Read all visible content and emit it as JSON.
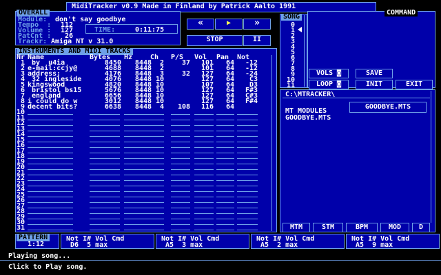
{
  "title": "MidiTracker v0.9 Made in Finland by Patrick Aalto 1991",
  "overall": {
    "header": "OVERALL",
    "fields": [
      {
        "label": "Module:",
        "value": "don't say goodbye"
      },
      {
        "label": "Tempo  :",
        "value": "112"
      },
      {
        "label": "Volume :",
        "value": "127"
      },
      {
        "label": "PatCnt :",
        "value": "26"
      },
      {
        "label": "Trackr:",
        "value": "Amiga NT v 31.0"
      }
    ]
  },
  "time": {
    "label": "TIME:",
    "value": "0:11:75"
  },
  "transport": {
    "rewind": "«",
    "play": "▶",
    "forward": "»",
    "stop": "STOP",
    "pause": "II"
  },
  "song": {
    "header": "SONG",
    "rows": [
      "0",
      "1",
      "2",
      "3",
      "4",
      "5",
      "6",
      "7",
      "8",
      "9",
      "10",
      "11"
    ]
  },
  "command": {
    "header": "COMMAND",
    "buttons": [
      {
        "label": "VOLS ◙"
      },
      {
        "label": "SAVE"
      },
      {
        "label": "LOOP ◙"
      },
      {
        "label": "INIT"
      },
      {
        "label": "EXIT"
      }
    ]
  },
  "files": {
    "path": "C:\\MTRACKER\\",
    "dir_header": "MT MODULES",
    "selected": "GOODBYE.MTS",
    "entries": [
      "GOODBYE.MTS"
    ]
  },
  "tabs": [
    "MTM",
    "STM",
    "BPM",
    "MOD",
    "D"
  ],
  "instruments": {
    "header": "INSTRUMENTS AND MIDI TRACKS",
    "columns": [
      "Nr",
      "Name",
      "Bytes",
      "Hz",
      "Ch",
      "P/S",
      "Vol",
      "Pan",
      "Not"
    ],
    "rows": [
      {
        "nr": "1",
        "name": " by  u4ia",
        "bytes": "8450",
        "hz": "8448",
        "ch": "2",
        "ps": "37",
        "vol": "101",
        "pan": "64",
        "not": "-12"
      },
      {
        "nr": "2",
        "name": "e-mail:ccjy@",
        "bytes": "4688",
        "hz": "8448",
        "ch": "2",
        "ps": "",
        "vol": "101",
        "pan": "64",
        "not": "-12"
      },
      {
        "nr": "3",
        "name": "address:",
        "bytes": "4176",
        "hz": "8448",
        "ch": "3",
        "ps": "32",
        "vol": "127",
        "pan": "64",
        "not": "-24"
      },
      {
        "nr": "4",
        "name": " 32 ingleside",
        "bytes": "4076",
        "hz": "8448",
        "ch": "10",
        "ps": "",
        "vol": "127",
        "pan": "64",
        "not": "C3"
      },
      {
        "nr": "5",
        "name": "kingswood",
        "bytes": "4820",
        "hz": "8448",
        "ch": "10",
        "ps": "",
        "vol": "107",
        "pan": "64",
        "not": "D3"
      },
      {
        "nr": "6",
        "name": " bristol bs15",
        "bytes": "5676",
        "hz": "8448",
        "ch": "10",
        "ps": "",
        "vol": "127",
        "pan": "64",
        "not": "F#3"
      },
      {
        "nr": "7",
        "name": " england",
        "bytes": "6656",
        "hz": "8448",
        "ch": "10",
        "ps": "",
        "vol": "127",
        "pan": "64",
        "not": "C#3"
      },
      {
        "nr": "8",
        "name": "i could do w",
        "bytes": "3012",
        "hz": "8448",
        "ch": "10",
        "ps": "",
        "vol": "127",
        "pan": "64",
        "not": "F#4"
      },
      {
        "nr": "9",
        "name": "decent bits?",
        "bytes": "6638",
        "hz": "8448",
        "ch": "4",
        "ps": "108",
        "vol": "116",
        "pan": "64",
        "not": ""
      },
      {
        "nr": "10"
      },
      {
        "nr": "11"
      },
      {
        "nr": "12"
      },
      {
        "nr": "13"
      },
      {
        "nr": "14"
      },
      {
        "nr": "15"
      },
      {
        "nr": "16"
      },
      {
        "nr": "17"
      },
      {
        "nr": "18"
      },
      {
        "nr": "19"
      },
      {
        "nr": "20"
      },
      {
        "nr": "21"
      },
      {
        "nr": "22"
      },
      {
        "nr": "23"
      },
      {
        "nr": "24"
      },
      {
        "nr": "25"
      },
      {
        "nr": "26"
      },
      {
        "nr": "27"
      },
      {
        "nr": "28"
      },
      {
        "nr": "29"
      },
      {
        "nr": "30"
      },
      {
        "nr": "31"
      }
    ]
  },
  "pattern": {
    "header": "PATTERN",
    "value": "1:12"
  },
  "tracks": [
    {
      "header": "Not I# Vol Cmd",
      "values": "D6  5 max"
    },
    {
      "header": "Not I# Vol Cmd",
      "values": "A5  3 max"
    },
    {
      "header": "Not I# Vol Cmd",
      "values": "A5  2 max"
    },
    {
      "header": "Not I# Vol Cmd",
      "values": "A5  9 max"
    }
  ],
  "status": {
    "line1": "Playing song...",
    "line2": "Click to Play song."
  },
  "colors": {
    "bg": "#0000aa",
    "border": "#6ea0e8",
    "accent": "#ffff55"
  }
}
